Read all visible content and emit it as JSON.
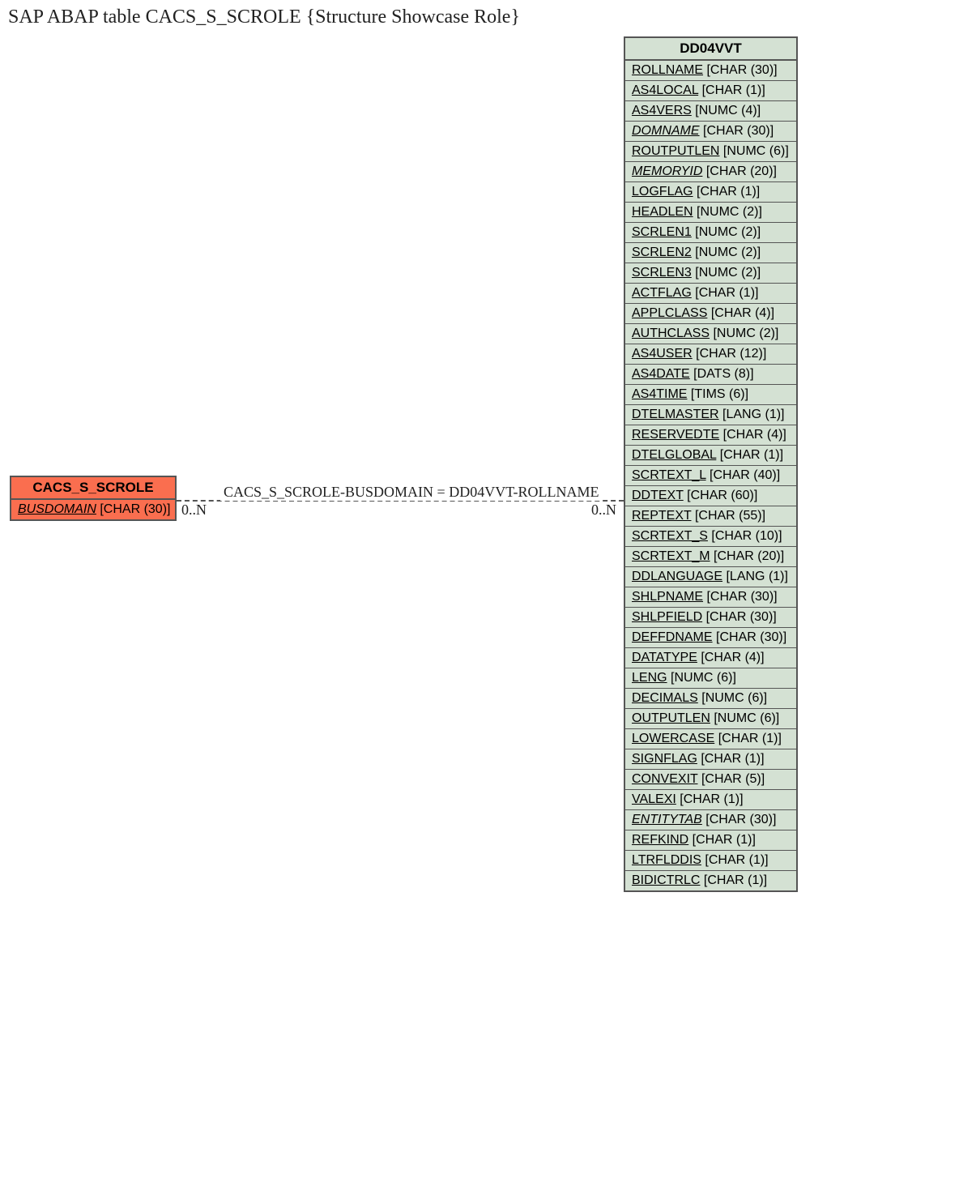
{
  "title": "SAP ABAP table CACS_S_SCROLE {Structure Showcase Role}",
  "left_entity": {
    "name": "CACS_S_SCROLE",
    "fields": [
      {
        "name": "BUSDOMAIN",
        "type": "[CHAR (30)]",
        "italic": true
      }
    ]
  },
  "right_entity": {
    "name": "DD04VVT",
    "fields": [
      {
        "name": "ROLLNAME",
        "type": "[CHAR (30)]",
        "italic": false
      },
      {
        "name": "AS4LOCAL",
        "type": "[CHAR (1)]",
        "italic": false
      },
      {
        "name": "AS4VERS",
        "type": "[NUMC (4)]",
        "italic": false
      },
      {
        "name": "DOMNAME",
        "type": "[CHAR (30)]",
        "italic": true
      },
      {
        "name": "ROUTPUTLEN",
        "type": "[NUMC (6)]",
        "italic": false
      },
      {
        "name": "MEMORYID",
        "type": "[CHAR (20)]",
        "italic": true
      },
      {
        "name": "LOGFLAG",
        "type": "[CHAR (1)]",
        "italic": false
      },
      {
        "name": "HEADLEN",
        "type": "[NUMC (2)]",
        "italic": false
      },
      {
        "name": "SCRLEN1",
        "type": "[NUMC (2)]",
        "italic": false
      },
      {
        "name": "SCRLEN2",
        "type": "[NUMC (2)]",
        "italic": false
      },
      {
        "name": "SCRLEN3",
        "type": "[NUMC (2)]",
        "italic": false
      },
      {
        "name": "ACTFLAG",
        "type": "[CHAR (1)]",
        "italic": false
      },
      {
        "name": "APPLCLASS",
        "type": "[CHAR (4)]",
        "italic": false
      },
      {
        "name": "AUTHCLASS",
        "type": "[NUMC (2)]",
        "italic": false
      },
      {
        "name": "AS4USER",
        "type": "[CHAR (12)]",
        "italic": false
      },
      {
        "name": "AS4DATE",
        "type": "[DATS (8)]",
        "italic": false
      },
      {
        "name": "AS4TIME",
        "type": "[TIMS (6)]",
        "italic": false
      },
      {
        "name": "DTELMASTER",
        "type": "[LANG (1)]",
        "italic": false
      },
      {
        "name": "RESERVEDTE",
        "type": "[CHAR (4)]",
        "italic": false
      },
      {
        "name": "DTELGLOBAL",
        "type": "[CHAR (1)]",
        "italic": false
      },
      {
        "name": "SCRTEXT_L",
        "type": "[CHAR (40)]",
        "italic": false
      },
      {
        "name": "DDTEXT",
        "type": "[CHAR (60)]",
        "italic": false
      },
      {
        "name": "REPTEXT",
        "type": "[CHAR (55)]",
        "italic": false
      },
      {
        "name": "SCRTEXT_S",
        "type": "[CHAR (10)]",
        "italic": false
      },
      {
        "name": "SCRTEXT_M",
        "type": "[CHAR (20)]",
        "italic": false
      },
      {
        "name": "DDLANGUAGE",
        "type": "[LANG (1)]",
        "italic": false
      },
      {
        "name": "SHLPNAME",
        "type": "[CHAR (30)]",
        "italic": false
      },
      {
        "name": "SHLPFIELD",
        "type": "[CHAR (30)]",
        "italic": false
      },
      {
        "name": "DEFFDNAME",
        "type": "[CHAR (30)]",
        "italic": false
      },
      {
        "name": "DATATYPE",
        "type": "[CHAR (4)]",
        "italic": false
      },
      {
        "name": "LENG",
        "type": "[NUMC (6)]",
        "italic": false
      },
      {
        "name": "DECIMALS",
        "type": "[NUMC (6)]",
        "italic": false
      },
      {
        "name": "OUTPUTLEN",
        "type": "[NUMC (6)]",
        "italic": false
      },
      {
        "name": "LOWERCASE",
        "type": "[CHAR (1)]",
        "italic": false
      },
      {
        "name": "SIGNFLAG",
        "type": "[CHAR (1)]",
        "italic": false
      },
      {
        "name": "CONVEXIT",
        "type": "[CHAR (5)]",
        "italic": false
      },
      {
        "name": "VALEXI",
        "type": "[CHAR (1)]",
        "italic": false
      },
      {
        "name": "ENTITYTAB",
        "type": "[CHAR (30)]",
        "italic": true
      },
      {
        "name": "REFKIND",
        "type": "[CHAR (1)]",
        "italic": false
      },
      {
        "name": "LTRFLDDIS",
        "type": "[CHAR (1)]",
        "italic": false
      },
      {
        "name": "BIDICTRLC",
        "type": "[CHAR (1)]",
        "italic": false
      }
    ]
  },
  "relation": {
    "label": "CACS_S_SCROLE-BUSDOMAIN = DD04VVT-ROLLNAME",
    "left_card": "0..N",
    "right_card": "0..N"
  }
}
